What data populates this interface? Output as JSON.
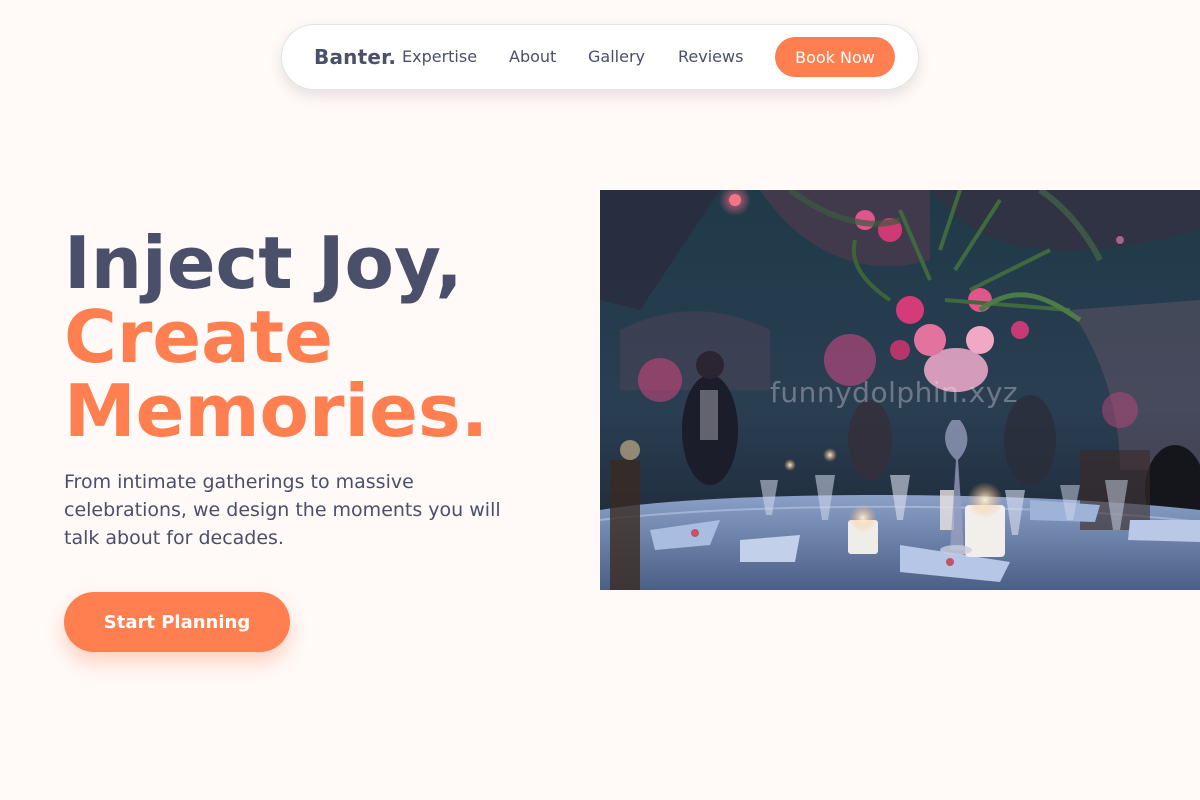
{
  "nav": {
    "brand": "Banter.",
    "links": [
      "Expertise",
      "About",
      "Gallery",
      "Reviews"
    ],
    "book_label": "Book Now"
  },
  "hero": {
    "headline_line1": "Inject Joy,",
    "headline_line2": "Create",
    "headline_line3": "Memories.",
    "subtext": "From intimate gatherings to massive celebrations, we design the moments you will talk about for decades.",
    "cta_label": "Start Planning"
  },
  "image": {
    "watermark": "funnydolphin.xyz"
  },
  "colors": {
    "accent": "#ff7f50",
    "text": "#4a4f6a",
    "background": "#fff9f7"
  }
}
